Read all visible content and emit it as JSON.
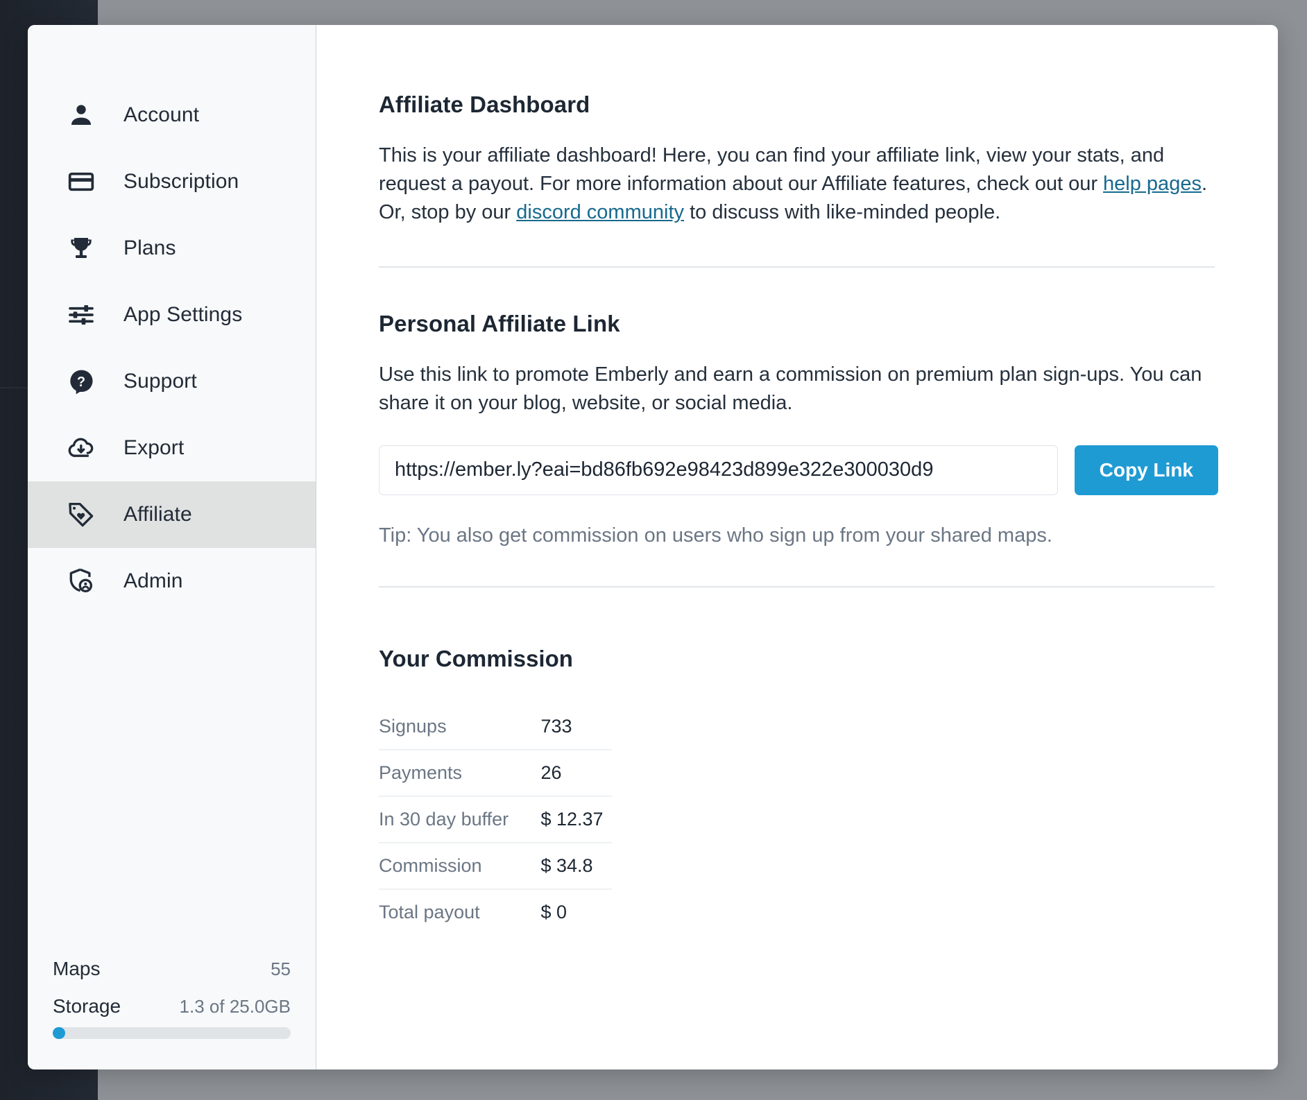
{
  "sidebar": {
    "items": [
      {
        "label": "Account",
        "icon": "person-icon",
        "active": false
      },
      {
        "label": "Subscription",
        "icon": "credit-card-icon",
        "active": false
      },
      {
        "label": "Plans",
        "icon": "trophy-icon",
        "active": false
      },
      {
        "label": "App Settings",
        "icon": "sliders-icon",
        "active": false
      },
      {
        "label": "Support",
        "icon": "question-mark-icon",
        "active": false
      },
      {
        "label": "Export",
        "icon": "cloud-download-icon",
        "active": false
      },
      {
        "label": "Affiliate",
        "icon": "tag-heart-icon",
        "active": true
      },
      {
        "label": "Admin",
        "icon": "shield-person-icon",
        "active": false
      }
    ],
    "footer": {
      "maps_label": "Maps",
      "maps_value": "55",
      "storage_label": "Storage",
      "storage_value": "1.3 of 25.0GB",
      "storage_percent": 5.2
    }
  },
  "main": {
    "dashboard": {
      "title": "Affiliate Dashboard",
      "intro_part_1": "This is your affiliate dashboard! Here, you can find your affiliate link, view your stats, and request a payout. For more information about our Affiliate features, check out our ",
      "link_help_pages": "help pages",
      "intro_part_2": ". Or, stop by our ",
      "link_discord": "discord community",
      "intro_part_3": " to discuss with like-minded people."
    },
    "affiliate_link": {
      "title": "Personal Affiliate Link",
      "description": "Use this link to promote Emberly and earn a commission on premium plan sign-ups. You can share it on your blog, website, or social media.",
      "url_value": "https://ember.ly?eai=bd86fb692e98423d899e322e300030d9",
      "url_placeholder": "https://ember.ly?eai=",
      "copy_button": "Copy Link",
      "tip": "Tip: You also get commission on users who sign up from your shared maps."
    },
    "commission": {
      "title": "Your Commission",
      "rows": [
        {
          "label": "Signups",
          "value": "733"
        },
        {
          "label": "Payments",
          "value": "26"
        },
        {
          "label": "In 30 day buffer",
          "value": "$ 12.37"
        },
        {
          "label": "Commission",
          "value": "$ 34.8"
        },
        {
          "label": "Total payout",
          "value": "$ 0"
        }
      ]
    }
  },
  "colors": {
    "accent_blue": "#1f9bd4",
    "link_blue": "#17698e",
    "sidebar_bg": "#f7f9fa",
    "active_item_bg": "#e0e2e2",
    "text_dark": "#1d2733",
    "text_muted": "#6b7684",
    "scrim_gray": "#8e9297",
    "app_dark": "#222a34"
  }
}
